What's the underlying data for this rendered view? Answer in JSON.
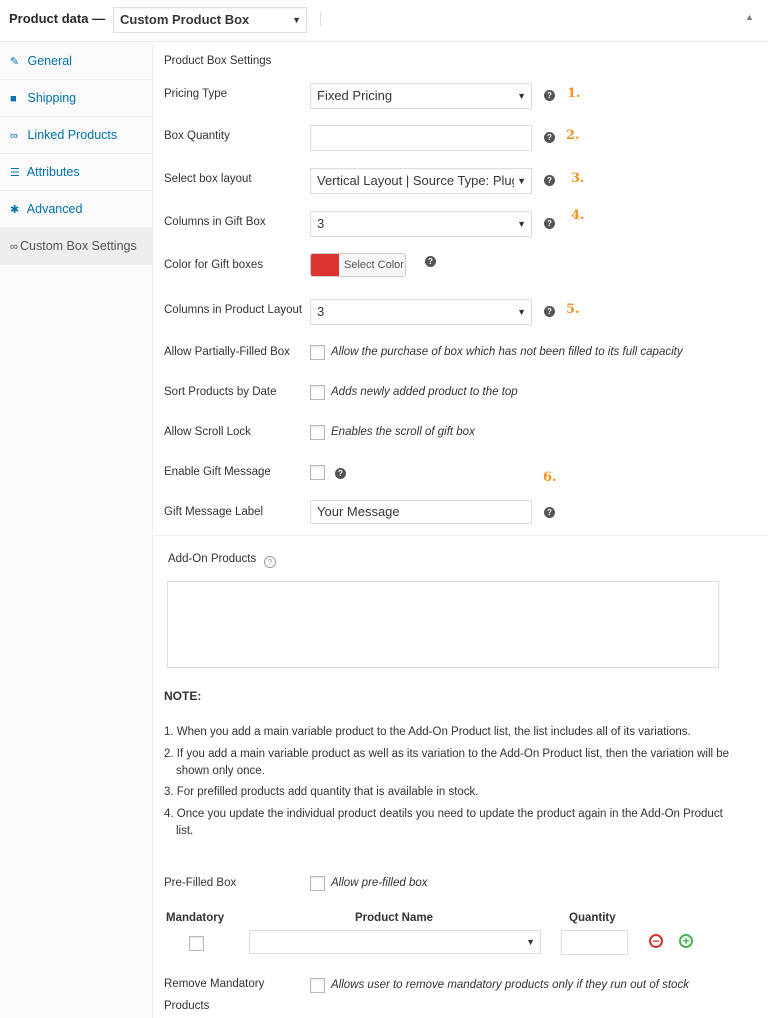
{
  "header": {
    "title": "Product data —",
    "product_type": "Custom Product Box"
  },
  "sidebar": {
    "items": [
      {
        "label": "General",
        "icon": "wrench-icon"
      },
      {
        "label": "Shipping",
        "icon": "truck-icon"
      },
      {
        "label": "Linked Products",
        "icon": "link-icon"
      },
      {
        "label": "Attributes",
        "icon": "list-icon"
      },
      {
        "label": "Advanced",
        "icon": "gear-icon"
      },
      {
        "label": "Custom Box Settings",
        "icon": "link-icon"
      }
    ],
    "active_index": 5
  },
  "section_title": "Product Box Settings",
  "fields": {
    "pricing_type": {
      "label": "Pricing Type",
      "value": "Fixed Pricing",
      "marker": "1."
    },
    "box_quantity": {
      "label": "Box Quantity",
      "value": "",
      "marker": "2."
    },
    "box_layout": {
      "label": "Select box layout",
      "value": "Vertical Layout | Source Type: Plug",
      "marker": "3."
    },
    "gift_columns": {
      "label": "Columns in Gift Box",
      "value": "3",
      "marker": "4."
    },
    "gift_color": {
      "label": "Color for Gift boxes",
      "button": "Select Color",
      "color": "#dd3333"
    },
    "product_columns": {
      "label": "Columns in Product Layout",
      "value": "3",
      "marker": "5."
    },
    "partial": {
      "label": "Allow Partially-Filled Box",
      "desc": "Allow the purchase of box which has not been filled to its full capacity"
    },
    "sort_date": {
      "label": "Sort Products by Date",
      "desc": "Adds newly added product to the top"
    },
    "scroll_lock": {
      "label": "Allow Scroll Lock",
      "desc": "Enables the scroll of gift box"
    },
    "gift_message": {
      "label": "Enable Gift Message",
      "marker": "6."
    },
    "gift_message_label": {
      "label": "Gift Message Label",
      "value": "Your Message"
    }
  },
  "addons": {
    "label": "Add-On Products",
    "help": "?"
  },
  "note": {
    "title": "NOTE:",
    "items": [
      "1. When you add a main variable product to the Add-On Product list, the list includes all of its variations.",
      "2. If you add a main variable product as well as its variation to the Add-On Product list, then the variation will be",
      "shown only once.",
      "3. For prefilled products add quantity that is available in stock.",
      "4. Once you update the individual product deatils you need to update the product again in the Add-On Product",
      "list."
    ]
  },
  "prefilled": {
    "label": "Pre-Filled Box",
    "desc": "Allow pre-filled box",
    "col_mandatory": "Mandatory",
    "col_product": "Product Name",
    "col_quantity": "Quantity",
    "product_value": "",
    "quantity_value": ""
  },
  "remove_mandatory": {
    "label_line1": "Remove Mandatory",
    "label_line2": "Products",
    "desc": "Allows user to remove mandatory products only if they run out of stock"
  }
}
